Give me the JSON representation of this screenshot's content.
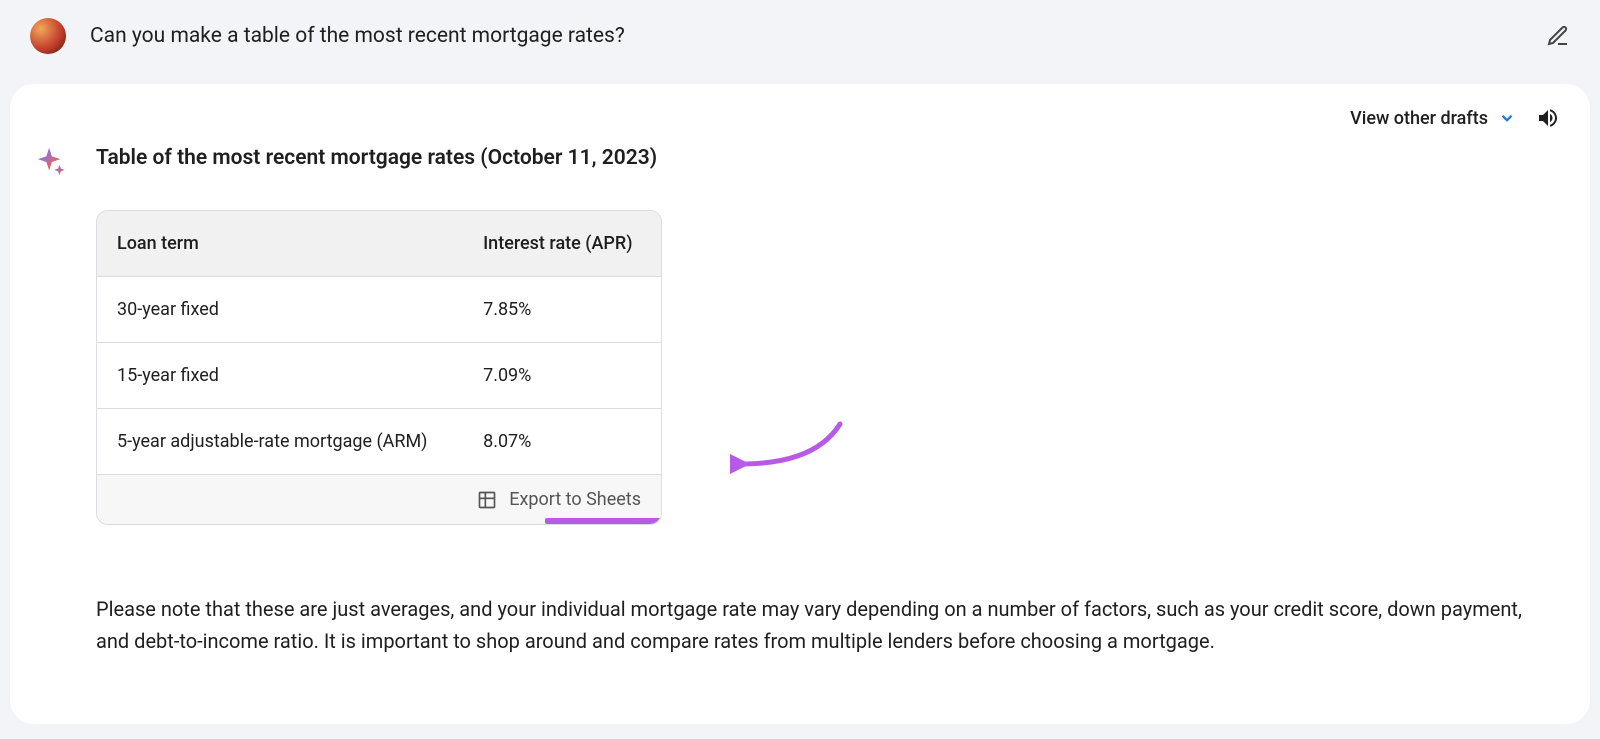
{
  "prompt": {
    "text": "Can you make a table of the most recent mortgage rates?"
  },
  "response": {
    "view_drafts_label": "View other drafts",
    "title": "Table of the most recent mortgage rates (October 11, 2023)",
    "table": {
      "headers": {
        "col1": "Loan term",
        "col2": "Interest rate (APR)"
      },
      "rows": [
        {
          "term": "30-year fixed",
          "rate": "7.85%"
        },
        {
          "term": "15-year fixed",
          "rate": "7.09%"
        },
        {
          "term": "5-year adjustable-rate mortgage (ARM)",
          "rate": "8.07%"
        }
      ],
      "export_label": "Export to Sheets"
    },
    "note": "Please note that these are just averages, and your individual mortgage rate may vary depending on a number of factors, such as your credit score, down payment, and debt-to-income ratio. It is important to shop around and compare rates from multiple lenders before choosing a mortgage."
  }
}
